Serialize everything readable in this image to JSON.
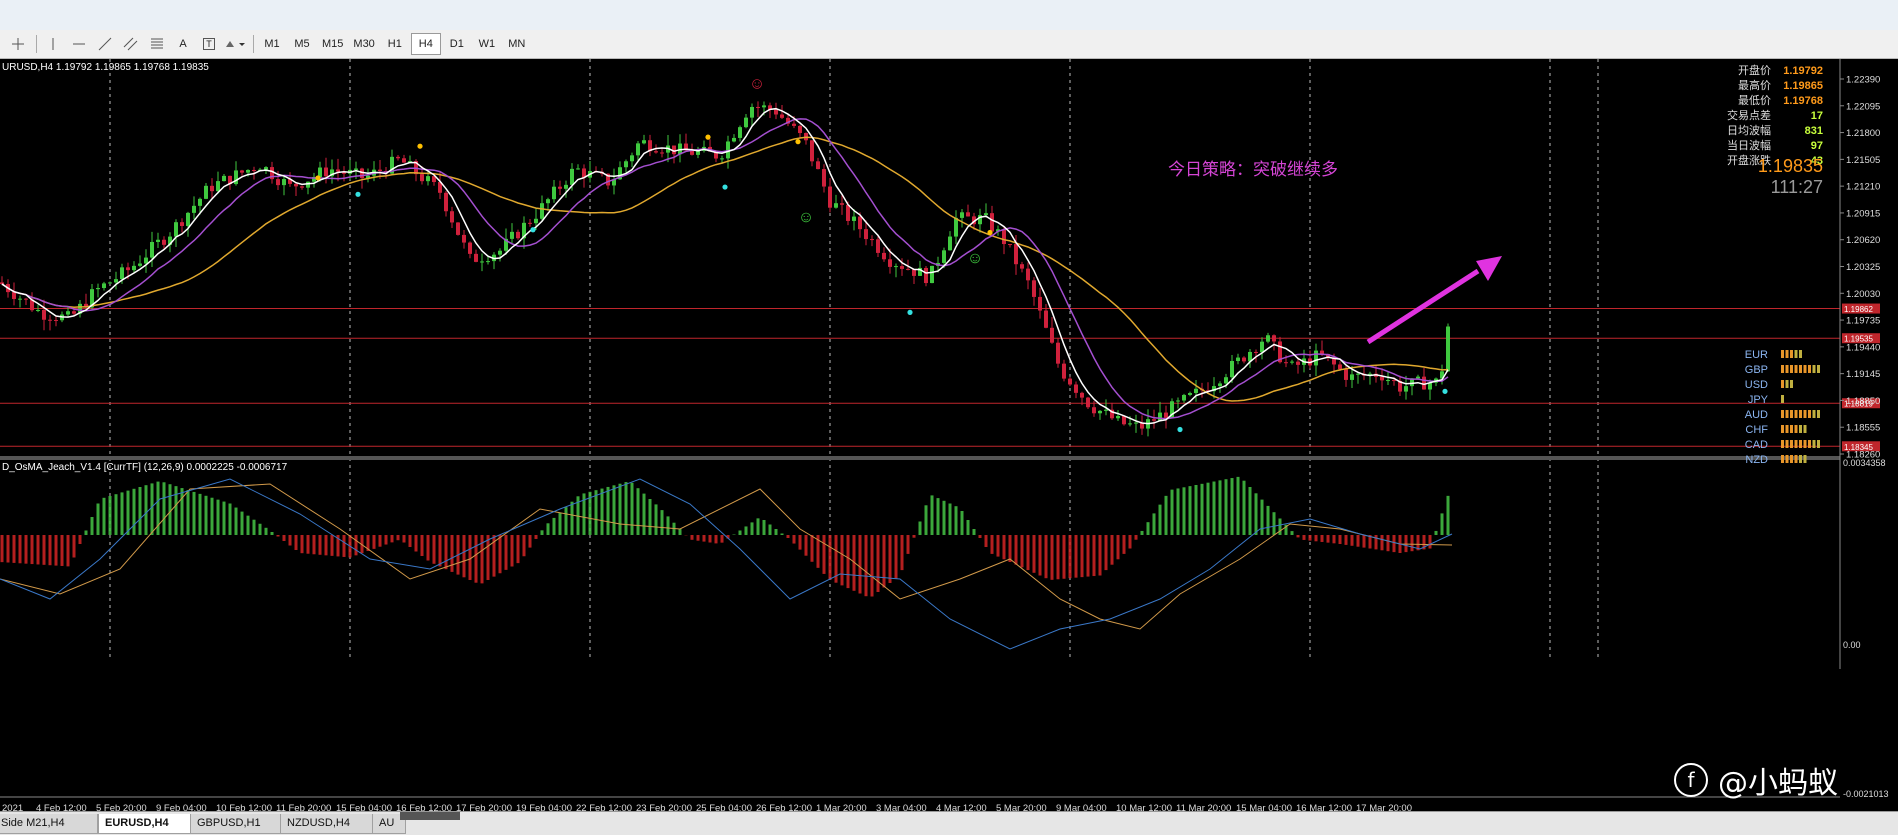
{
  "toolbar": {
    "tools": [
      {
        "name": "crosshair-icon"
      },
      {
        "name": "vertical-line-icon"
      },
      {
        "name": "horizontal-line-icon"
      },
      {
        "name": "trendline-icon"
      },
      {
        "name": "channel-icon"
      },
      {
        "name": "fibonacci-icon"
      },
      {
        "name": "text-tool-icon",
        "label": "A"
      },
      {
        "name": "text-label-icon",
        "label": "T"
      },
      {
        "name": "shapes-menu-icon"
      }
    ],
    "timeframes": [
      "M1",
      "M5",
      "M15",
      "M30",
      "H1",
      "H4",
      "D1",
      "W1",
      "MN"
    ],
    "active_timeframe": "H4"
  },
  "chart": {
    "symbol_line": "URUSD,H4  1.19792 1.19865 1.19768 1.19835",
    "strategy_text": "今日策略：突破继续多",
    "info_panel": [
      {
        "label": "开盘价",
        "value": "1.19792",
        "color": "#ff9a1a"
      },
      {
        "label": "最高价",
        "value": "1.19865",
        "color": "#ff9a1a"
      },
      {
        "label": "最低价",
        "value": "1.19768",
        "color": "#ff9a1a"
      },
      {
        "label": "交易点差",
        "value": "17",
        "color": "#c8ff3c"
      },
      {
        "label": "日均波幅",
        "value": "831",
        "color": "#c8ff3c"
      },
      {
        "label": "当日波幅",
        "value": "97",
        "color": "#c8ff3c"
      },
      {
        "label": "开盘涨跌",
        "value": "43",
        "color": "#c8ff3c"
      }
    ],
    "current_price": "1.19835",
    "countdown": "111:27",
    "price_axis": [
      "1.22390",
      "1.22095",
      "1.21800",
      "1.21505",
      "1.21210",
      "1.20915",
      "1.20620",
      "1.20325",
      "1.20030",
      "1.19735",
      "1.19440",
      "1.19145",
      "1.18850",
      "1.18555",
      "1.18260"
    ],
    "hline_tags": [
      "1.19862",
      "1.19535",
      "1.18819",
      "1.18345"
    ],
    "currency_strength": [
      {
        "code": "EUR",
        "bars": 5
      },
      {
        "code": "GBP",
        "bars": 9
      },
      {
        "code": "USD",
        "bars": 3
      },
      {
        "code": "JPY",
        "bars": 1
      },
      {
        "code": "AUD",
        "bars": 9
      },
      {
        "code": "CHF",
        "bars": 6
      },
      {
        "code": "CAD",
        "bars": 9
      },
      {
        "code": "NZD",
        "bars": 6
      }
    ],
    "indicator_label": "D_OsMA_Jeach_V1.4 [CurrTF] (12,26,9) 0.0002225 -0.0006717",
    "indicator_axis": [
      "0.0034358",
      "0.00",
      "-0.0021013"
    ],
    "time_axis": [
      "2021",
      "4 Feb 12:00",
      "5 Feb 20:00",
      "9 Feb 04:00",
      "10 Feb 12:00",
      "11 Feb 20:00",
      "15 Feb 04:00",
      "16 Feb 12:00",
      "17 Feb 20:00",
      "19 Feb 04:00",
      "22 Feb 12:00",
      "23 Feb 20:00",
      "25 Feb 04:00",
      "26 Feb 12:00",
      "1 Mar 20:00",
      "3 Mar 04:00",
      "4 Mar 12:00",
      "5 Mar 20:00",
      "9 Mar 04:00",
      "10 Mar 12:00",
      "11 Mar 20:00",
      "15 Mar 04:00",
      "16 Mar 12:00",
      "17 Mar 20:00"
    ],
    "colors": {
      "bull": "#3fc93f",
      "bear": "#d0213c",
      "ma_fast": "#ffffff",
      "ma_mid": "#a44fd0",
      "ma_slow": "#e0a82e",
      "hline": "#c0262c",
      "arrow": "#e033e0",
      "osma_pos": "#45c445",
      "osma_neg": "#d42525"
    },
    "smiley_glyph": "☺"
  },
  "tabs": [
    "Side M21,H4",
    "EURUSD,H4",
    "GBPUSD,H1",
    "NZDUSD,H4",
    "AU"
  ],
  "active_tab": "EURUSD,H4",
  "watermark": {
    "logo": "f",
    "text": "@小蚂蚁"
  }
}
